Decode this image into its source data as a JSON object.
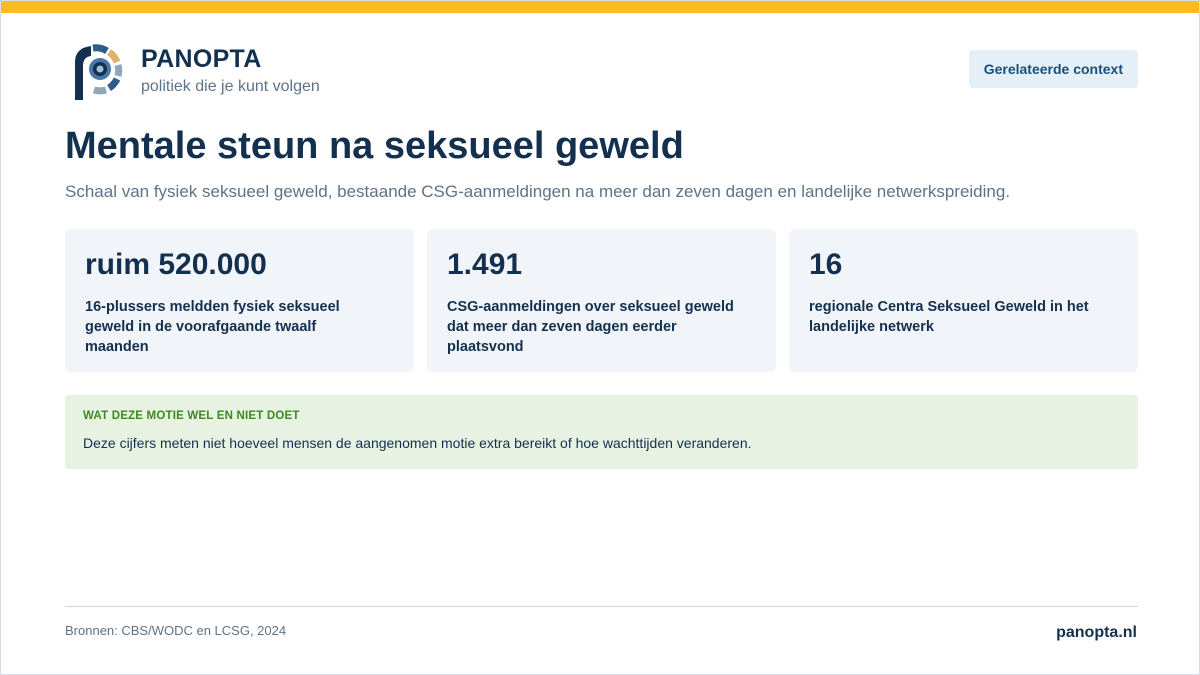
{
  "brand": {
    "name": "PANOPTA",
    "tagline": "politiek die je kunt volgen"
  },
  "header": {
    "context_button": "Gerelateerde context"
  },
  "page": {
    "title": "Mentale steun na seksueel geweld",
    "subtitle": "Schaal van fysiek seksueel geweld, bestaande CSG-aanmeldingen na meer dan zeven dagen en landelijke netwerkspreiding."
  },
  "stats": [
    {
      "value": "ruim 520.000",
      "label": "16-plussers meldden fysiek seksueel geweld in de voorafgaande twaalf maanden"
    },
    {
      "value": "1.491",
      "label": "CSG-aanmeldingen over seksueel geweld dat meer dan zeven dagen eerder plaatsvond"
    },
    {
      "value": "16",
      "label": "regionale Centra Seksueel Geweld in het landelijke netwerk"
    }
  ],
  "callout": {
    "heading": "WAT DEZE MOTIE WEL EN NIET DOET",
    "text": "Deze cijfers meten niet hoeveel mensen de aangenomen motie extra bereikt of hoe wachttijden veranderen."
  },
  "footer": {
    "sources": "Bronnen: CBS/WODC en LCSG, 2024",
    "site": "panopta.nl"
  },
  "colors": {
    "accent_bar": "#fbbd1c",
    "navy": "#14304f",
    "muted": "#5e7389",
    "card_bg": "#f1f4f8",
    "callout_bg": "#e7f2e2",
    "callout_heading": "#3d8a1e",
    "button_bg": "#e5eff7"
  },
  "icons": {
    "logo": "panopta-eye-logo-icon"
  }
}
